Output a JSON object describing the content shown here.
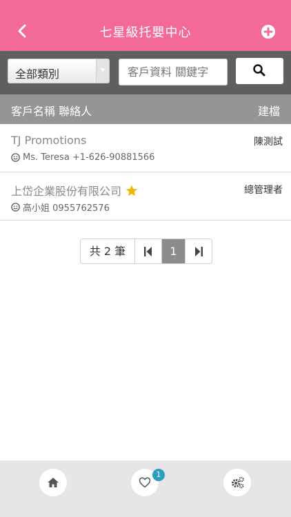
{
  "header": {
    "title": "七星級托嬰中心",
    "back_icon": "back-icon",
    "add_icon": "add-circle-icon",
    "color": "#f3699a"
  },
  "toolbar": {
    "category_selected": "全部類別",
    "search_placeholder": "客戶資料 關鍵字",
    "search_icon": "search-icon"
  },
  "columns": {
    "left": "客戶名稱 聯絡人",
    "right": "建檔"
  },
  "rows": [
    {
      "name": "TJ Promotions",
      "starred": false,
      "owner": "陳測試",
      "contact": "Ms. Teresa +1-626-90881566"
    },
    {
      "name": "上岱企業股份有限公司",
      "starred": true,
      "owner": "總管理者",
      "contact": "高小姐 0955762576"
    }
  ],
  "pager": {
    "total": "共 2 筆",
    "current_page": "1"
  },
  "footer": {
    "home_icon": "home-icon",
    "favorites_icon": "heart-icon",
    "favorites_count": "1",
    "settings_icon": "gears-icon"
  }
}
